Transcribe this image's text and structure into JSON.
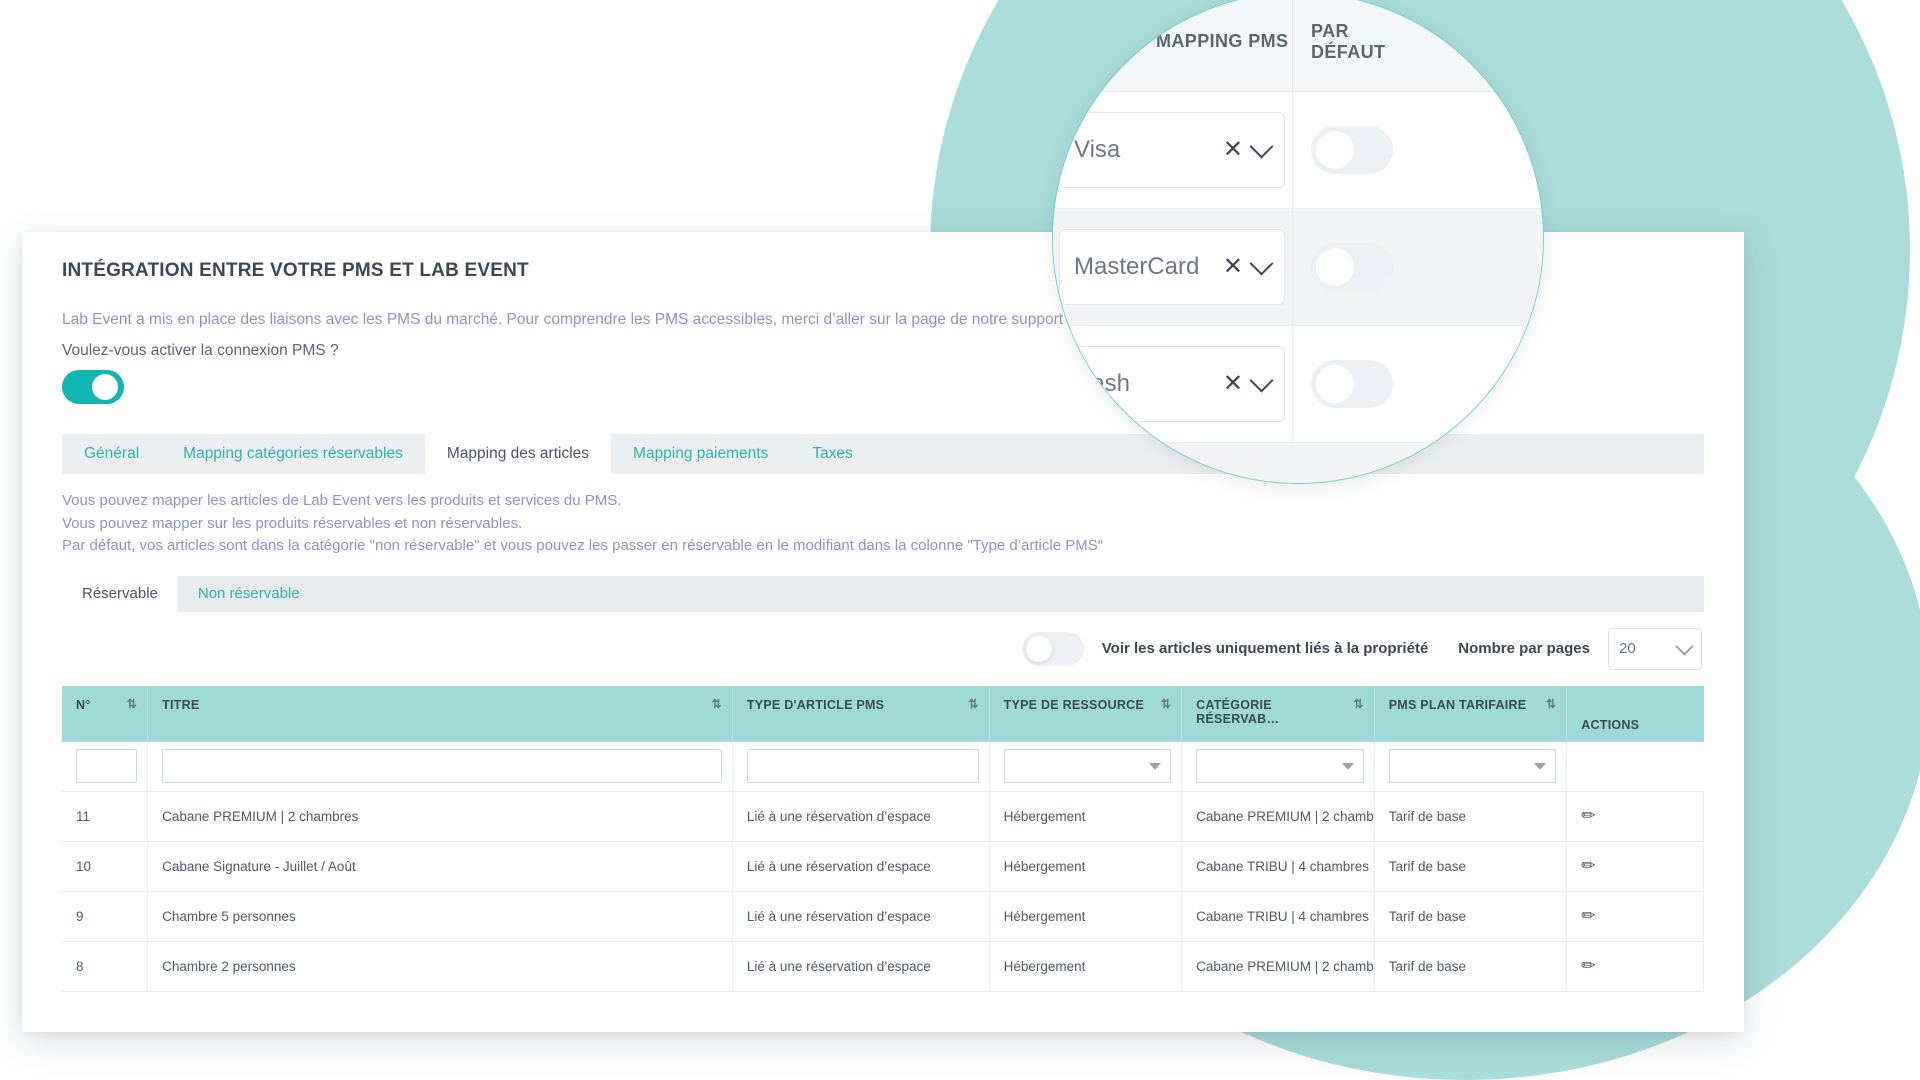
{
  "colors": {
    "accent_teal": "#0fb5ae",
    "tab_teal": "#2db1ae",
    "table_header": "#9ed9d7",
    "blob": "#a9dcdb",
    "lead_text": "#8a93c4"
  },
  "panel": {
    "title": "INTÉGRATION ENTRE VOTRE PMS ET LAB EVENT",
    "lead_text": "Lab Event a mis en place des liaisons avec les PMS du marché. Pour comprendre les PMS accessibles, merci d’aller sur la page de notre ",
    "lead_link": "support",
    "question": "Voulez-vous activer la connexion PMS ?",
    "connection_toggle_state": "on"
  },
  "tabs": [
    {
      "label": "Général",
      "active": false
    },
    {
      "label": "Mapping catégories réservables",
      "active": false
    },
    {
      "label": "Mapping des articles",
      "active": true
    },
    {
      "label": "Mapping paiements",
      "active": false
    },
    {
      "label": "Taxes",
      "active": false
    }
  ],
  "description": [
    "Vous pouvez mapper les articles de Lab Event vers les produits et services du PMS.",
    "Vous pouvez mapper sur les produits réservables et non réservables.",
    "Par défaut, vos articles sont dans la catégorie \"non réservable\" et vous pouvez les passer en réservable en le modifiant dans la colonne \"Type d’article PMS\""
  ],
  "subtabs": [
    {
      "label": "Réservable",
      "active": true
    },
    {
      "label": "Non réservable",
      "active": false
    }
  ],
  "toolbar": {
    "property_filter_toggle_state": "off",
    "property_filter_label": "Voir les articles uniquement liés à la propriété",
    "per_page_label": "Nombre par pages",
    "per_page_value": "20"
  },
  "table": {
    "columns": [
      {
        "label": "N°",
        "sortable": true
      },
      {
        "label": "TITRE",
        "sortable": true
      },
      {
        "label": "TYPE D'ARTICLE PMS",
        "sortable": true
      },
      {
        "label": "TYPE DE RESSOURCE",
        "sortable": true
      },
      {
        "label": "CATÉGORIE RÉSERVAB…",
        "sortable": true
      },
      {
        "label": "PMS PLAN TARIFAIRE",
        "sortable": true
      },
      {
        "label": "ACTIONS",
        "sortable": false
      }
    ],
    "filters": [
      {
        "type": "text",
        "value": ""
      },
      {
        "type": "text",
        "value": ""
      },
      {
        "type": "text",
        "value": ""
      },
      {
        "type": "select",
        "value": ""
      },
      {
        "type": "select",
        "value": ""
      },
      {
        "type": "select",
        "value": ""
      },
      {
        "type": "none",
        "value": ""
      }
    ],
    "rows": [
      {
        "num": "11",
        "titre": "Cabane PREMIUM | 2 chambres",
        "type_article_pms": "Lié à une réservation d’espace",
        "type_ressource": "Hébergement",
        "categorie_reservable": "Cabane PREMIUM | 2 chamb",
        "pms_plan_tarifaire": "Tarif de base",
        "action_icon": "pencil-icon"
      },
      {
        "num": "10",
        "titre": "Cabane Signature - Juillet / Août",
        "type_article_pms": "Lié à une réservation d’espace",
        "type_ressource": "Hébergement",
        "categorie_reservable": "Cabane TRIBU | 4 chambres",
        "pms_plan_tarifaire": "Tarif de base",
        "action_icon": "pencil-icon"
      },
      {
        "num": "9",
        "titre": "Chambre 5 personnes",
        "type_article_pms": "Lié à une réservation d’espace",
        "type_ressource": "Hébergement",
        "categorie_reservable": "Cabane TRIBU | 4 chambres",
        "pms_plan_tarifaire": "Tarif de base",
        "action_icon": "pencil-icon"
      },
      {
        "num": "8",
        "titre": "Chambre 2 personnes",
        "type_article_pms": "Lié à une réservation d’espace",
        "type_ressource": "Hébergement",
        "categorie_reservable": "Cabane PREMIUM | 2 chamb",
        "pms_plan_tarifaire": "Tarif de base",
        "action_icon": "pencil-icon"
      }
    ]
  },
  "magnifier": {
    "headers": {
      "mapping_pms": "MAPPING PMS",
      "par_defaut_line1": "PAR",
      "par_defaut_line2": "DÉFAUT"
    },
    "rows": [
      {
        "value": "Visa",
        "clear_icon": "close-icon",
        "chevron_icon": "chevron-down-icon",
        "default_toggle_state": "off"
      },
      {
        "value": "MasterCard",
        "clear_icon": "close-icon",
        "chevron_icon": "chevron-down-icon",
        "default_toggle_state": "off"
      },
      {
        "value": "Cash",
        "clear_icon": "close-icon",
        "chevron_icon": "chevron-down-icon",
        "default_toggle_state": "off"
      }
    ]
  }
}
